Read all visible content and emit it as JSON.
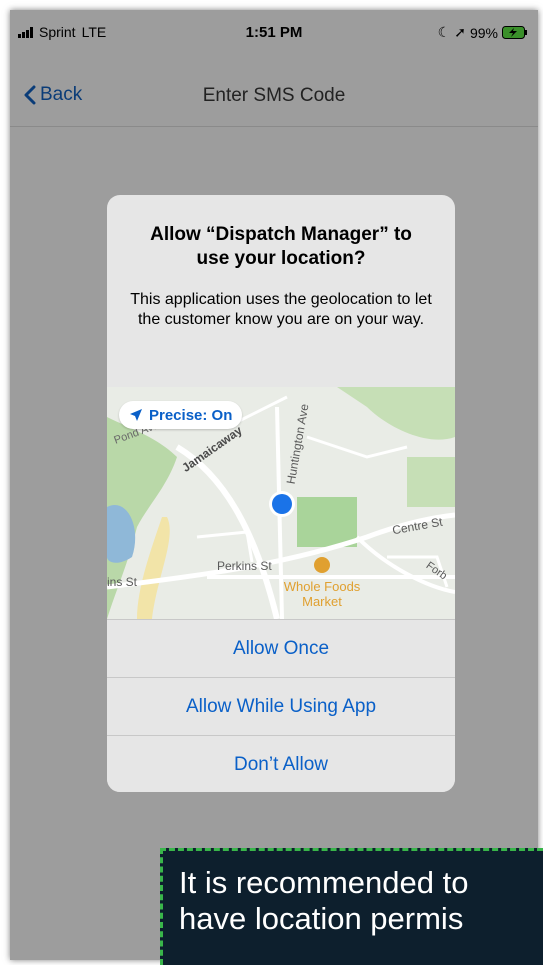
{
  "status": {
    "carrier": "Sprint",
    "network": "LTE",
    "time": "1:51 PM",
    "battery": "99%"
  },
  "nav": {
    "back_label": "Back",
    "title": "Enter SMS Code"
  },
  "alert": {
    "title": "Allow “Dispatch Manager” to use your location?",
    "message": "This application uses the geolocation to let the customer know you are on your way.",
    "precise_label": "Precise: On",
    "map_labels": {
      "pond_ave": "Pond Ave",
      "jamaicaway": "Jamaicaway",
      "huntington_ave": "Huntington Ave",
      "centre_st": "Centre St",
      "perkins_st": "Perkins St",
      "ins_st": "ins St",
      "forbes": "Forb",
      "whole_foods": "Whole Foods",
      "market": "Market"
    },
    "buttons": {
      "allow_once": "Allow Once",
      "allow_while_using": "Allow While Using App",
      "dont_allow": "Don’t Allow"
    }
  },
  "banner": {
    "text": "It is recommended to\nhave location permis"
  },
  "colors": {
    "accent": "#0a60c8",
    "overlay": "#9d9d9d",
    "banner_bg": "#0d1f2d",
    "banner_border": "#39b54a",
    "location_dot": "#1a73e8",
    "poi": "#e0a030"
  }
}
